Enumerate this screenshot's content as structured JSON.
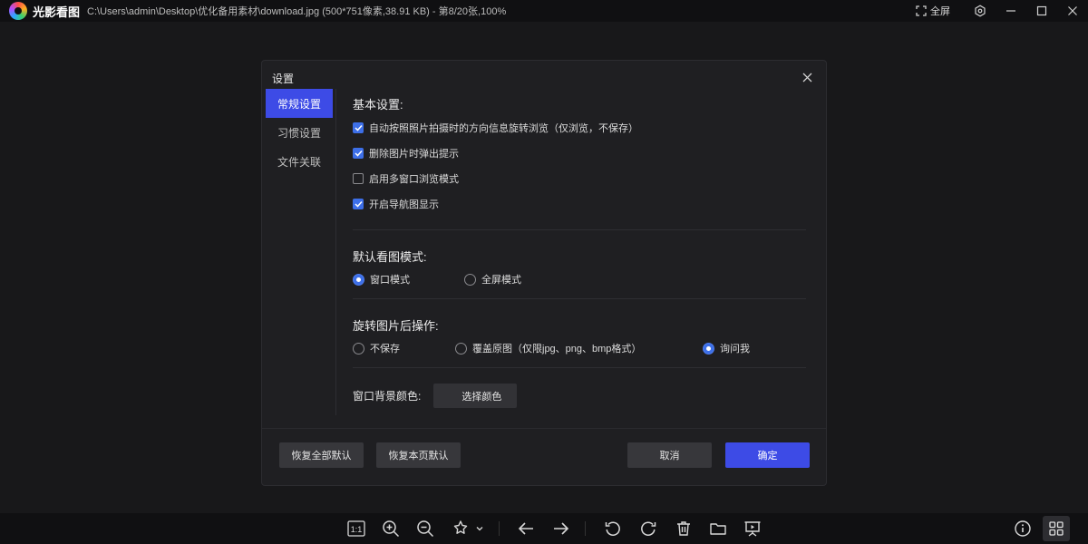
{
  "titlebar": {
    "app_name": "光影看图",
    "file_info": "C:\\Users\\admin\\Desktop\\优化备用素材\\download.jpg (500*751像素,38.91 KB) - 第8/20张,100%",
    "fullscreen_label": "全屏"
  },
  "dialog": {
    "title": "设置",
    "nav": [
      "常规设置",
      "习惯设置",
      "文件关联"
    ],
    "basic": {
      "title": "基本设置:",
      "options": [
        {
          "label": "自动按照照片拍摄时的方向信息旋转浏览（仅浏览，不保存）",
          "checked": true
        },
        {
          "label": "删除图片时弹出提示",
          "checked": true
        },
        {
          "label": "启用多窗口浏览模式",
          "checked": false
        },
        {
          "label": "开启导航图显示",
          "checked": true
        }
      ]
    },
    "view_mode": {
      "title": "默认看图模式:",
      "options": [
        {
          "label": "窗口模式",
          "selected": true
        },
        {
          "label": "全屏模式",
          "selected": false
        }
      ]
    },
    "rotate": {
      "title": "旋转图片后操作:",
      "options": [
        {
          "label": "不保存",
          "selected": false
        },
        {
          "label": "覆盖原图（仅限jpg、png、bmp格式）",
          "selected": false
        },
        {
          "label": "询问我",
          "selected": true
        }
      ]
    },
    "bg_color": {
      "label": "窗口背景颜色:",
      "button": "选择颜色"
    },
    "footer": {
      "reset_all": "恢复全部默认",
      "reset_page": "恢复本页默认",
      "cancel": "取消",
      "ok": "确定"
    }
  },
  "toolbar": {
    "actual_size": "1:1",
    "icons": [
      "actual-size-icon",
      "zoom-in-icon",
      "zoom-out-icon",
      "magic-icon",
      "prev-icon",
      "next-icon",
      "rotate-left-icon",
      "rotate-right-icon",
      "delete-icon",
      "folder-icon",
      "slideshow-icon",
      "info-icon",
      "grid-icon"
    ]
  },
  "colors": {
    "accent": "#3d4be6",
    "checkbox": "#3d6fe8"
  }
}
